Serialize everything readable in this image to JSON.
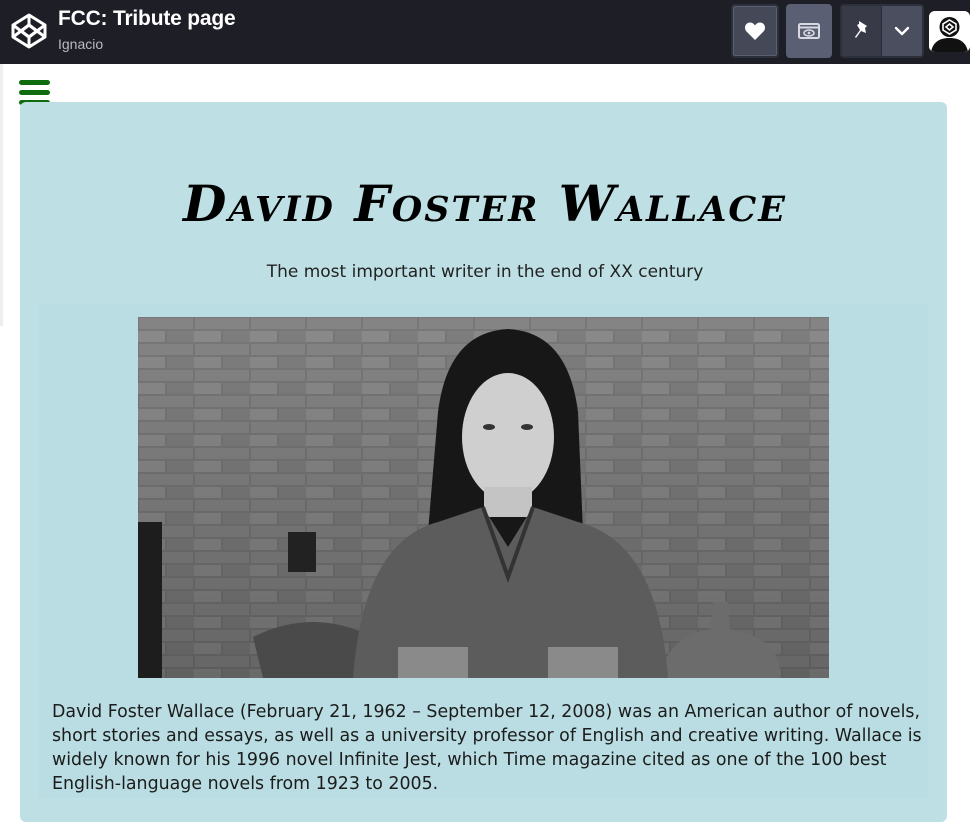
{
  "header": {
    "title": "FCC: Tribute page",
    "author": "Ignacio",
    "icons": {
      "logo": "codepen-logo-icon",
      "heart": "heart-icon",
      "view": "eye-box-icon",
      "pin": "pin-icon",
      "chevron": "chevron-down-icon",
      "avatar": "user-avatar-icon"
    }
  },
  "page": {
    "menu_icon": "hamburger-menu-icon",
    "title": "David Foster Wallace",
    "subtitle": "The most important writer in the end of XX century",
    "bio": "David Foster Wallace (February 21, 1962 – September 12, 2008) was an American author of novels, short stories and essays, as well as a university professor of English and creative writing. Wallace is widely known for his 1996 novel Infinite Jest, which Time magazine cited as one of the 100 best English-language novels from 1923 to 2005."
  },
  "colors": {
    "topbar": "#1e1f26",
    "card": "#bee0e5",
    "menu": "#0e6b0e"
  }
}
